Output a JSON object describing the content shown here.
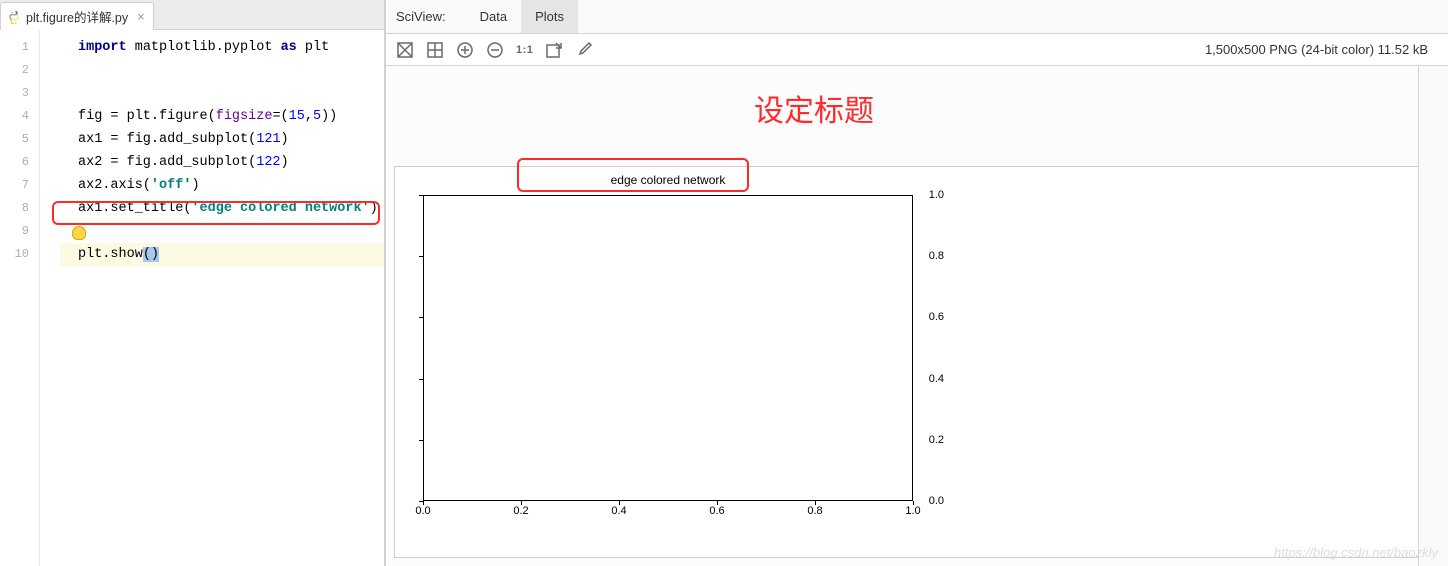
{
  "editor": {
    "tab_filename": "plt.figure的详解.py",
    "lines": [
      {
        "n": 1,
        "tokens": [
          [
            "kw",
            "import"
          ],
          [
            " ",
            ""
          ],
          [
            "ident",
            "matplotlib.pyplot"
          ],
          [
            " ",
            ""
          ],
          [
            "kw",
            "as"
          ],
          [
            " ",
            ""
          ],
          [
            "ident",
            "plt"
          ]
        ]
      },
      {
        "n": 2,
        "tokens": []
      },
      {
        "n": 3,
        "tokens": []
      },
      {
        "n": 4,
        "tokens": [
          [
            "ident",
            "fig = plt.figure("
          ],
          [
            "ident2",
            "figsize"
          ],
          [
            "ident",
            "=("
          ],
          [
            "num",
            "15"
          ],
          [
            "ident",
            ","
          ],
          [
            "num",
            "5"
          ],
          [
            "ident",
            "))"
          ]
        ]
      },
      {
        "n": 5,
        "tokens": [
          [
            "ident",
            "ax1 = fig.add_subplot("
          ],
          [
            "num",
            "121"
          ],
          [
            "ident",
            ")"
          ]
        ]
      },
      {
        "n": 6,
        "tokens": [
          [
            "ident",
            "ax2 = fig.add_subplot("
          ],
          [
            "num",
            "122"
          ],
          [
            "ident",
            ")"
          ]
        ]
      },
      {
        "n": 7,
        "tokens": [
          [
            "ident",
            "ax2.axis("
          ],
          [
            "str-q",
            "'"
          ],
          [
            "str",
            "off"
          ],
          [
            "str-q",
            "'"
          ],
          [
            "ident",
            ")"
          ]
        ]
      },
      {
        "n": 8,
        "tokens": [
          [
            "ident",
            "ax1.set_title("
          ],
          [
            "str-q",
            "'"
          ],
          [
            "str",
            "edge colored network"
          ],
          [
            "str-q",
            "'"
          ],
          [
            "ident",
            ")"
          ]
        ]
      },
      {
        "n": 9,
        "tokens": []
      },
      {
        "n": 10,
        "tokens": [
          [
            "ident",
            "plt.show"
          ],
          [
            "sel",
            "()"
          ]
        ]
      }
    ]
  },
  "sciview": {
    "title": "SciView:",
    "tab_data": "Data",
    "tab_plots": "Plots",
    "toolbar_11": "1:1",
    "info": "1,500x500 PNG (24-bit color) 11.52 kB",
    "annotation": "设定标题",
    "watermark": "https://blog.csdn.net/baozkly"
  },
  "chart_data": {
    "type": "line",
    "title": "edge colored network",
    "xlabel": "",
    "ylabel": "",
    "xlim": [
      0.0,
      1.0
    ],
    "ylim": [
      0.0,
      1.0
    ],
    "xticks": [
      0.0,
      0.2,
      0.4,
      0.6,
      0.8,
      1.0
    ],
    "yticks": [
      0.0,
      0.2,
      0.4,
      0.6,
      0.8,
      1.0
    ],
    "series": []
  }
}
